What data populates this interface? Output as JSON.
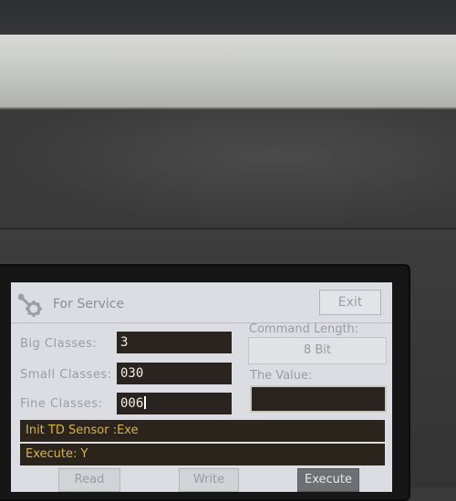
{
  "window": {
    "title": "For Service",
    "exit_label": "Exit"
  },
  "fields": {
    "big_classes": {
      "label": "Big  Classes:",
      "value": "3"
    },
    "small_classes": {
      "label": "Small Classes:",
      "value": "030"
    },
    "fine_classes": {
      "label": "Fine  Classes:",
      "value": "006"
    }
  },
  "command": {
    "label": "Command Length:",
    "value": "8 Bit"
  },
  "the_value": {
    "label": "The Value:",
    "value": ""
  },
  "status": {
    "line1": "Init TD Sensor :Exe",
    "line2": "Execute: Y"
  },
  "buttons": {
    "read": "Read",
    "write": "Write",
    "execute": "Execute"
  },
  "colors": {
    "screen_bg": "#dcdde2",
    "input_bg": "#2a2420",
    "status_text": "#d7b24f"
  },
  "icons": {
    "title_icon": "gear-wrench-icon"
  }
}
